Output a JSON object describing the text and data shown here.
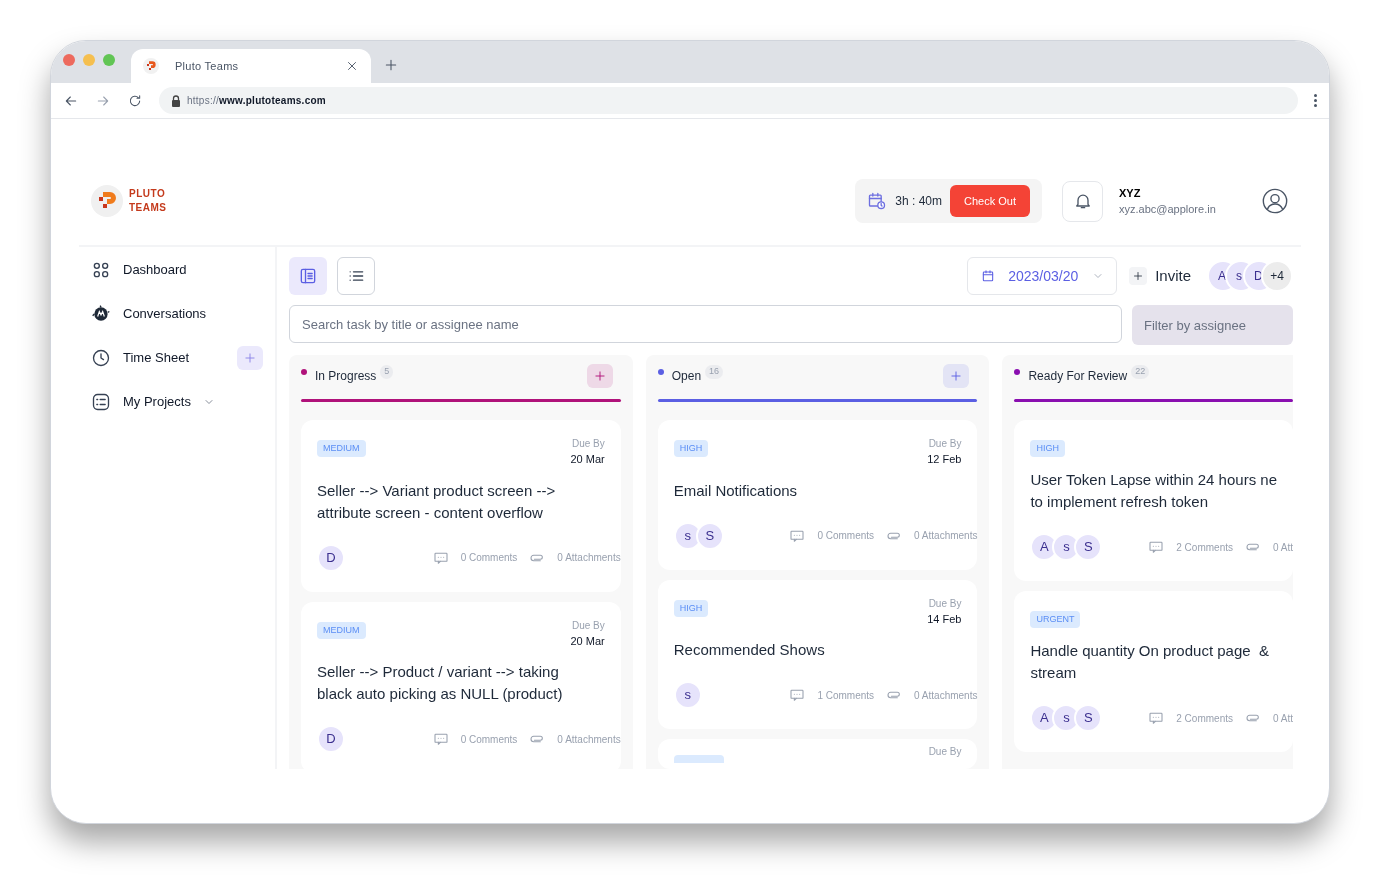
{
  "browser": {
    "tab_title": "Pluto Teams",
    "url_scheme": "https://",
    "url_host": "www.plutoteams.com"
  },
  "brand": {
    "line1": "PLUTO",
    "line2": "TEAMS"
  },
  "timer": {
    "value": "3h : 40m",
    "button": "Check Out"
  },
  "user": {
    "name": "XYZ",
    "email": "xyz.abc@applore.in"
  },
  "sidebar": {
    "items": [
      {
        "label": "Dashboard",
        "kind": "plain"
      },
      {
        "label": "Conversations",
        "kind": "plain"
      },
      {
        "label": "Time Sheet",
        "kind": "add"
      },
      {
        "label": "My Projects",
        "kind": "expand"
      }
    ]
  },
  "view_toggle": [
    {
      "kind": "board",
      "selected": true
    },
    {
      "kind": "list",
      "selected": false
    }
  ],
  "date": "2023/03/20",
  "invite": "Invite",
  "members": [
    "A",
    "s",
    "D"
  ],
  "more_members": "+4",
  "search": {
    "placeholder": "Search task by title or assignee name"
  },
  "filter": {
    "placeholder": "Filter by assignee"
  },
  "columns": [
    {
      "title": "In Progress",
      "count": "5",
      "color": "#b0127a",
      "add": true,
      "cards": [
        {
          "kind": "task",
          "priority": "MEDIUM",
          "due_label": "Due By",
          "due": "20 Mar",
          "title": "Seller --> Variant product screen -->\nattribute screen - content overflow",
          "assignees": [
            "D"
          ],
          "comments": "0 Comments",
          "attachments": "0 Attachments"
        },
        {
          "kind": "task",
          "priority": "MEDIUM",
          "due_label": "Due By",
          "due": "20 Mar",
          "title": "Seller --> Product / variant --> taking\nblack auto picking as NULL (product)",
          "assignees": [
            "D"
          ],
          "comments": "0 Comments",
          "attachments": "0 Attachments"
        }
      ]
    },
    {
      "title": "Open",
      "count": "16",
      "color": "#5b5fe3",
      "add": true,
      "cards": [
        {
          "kind": "task",
          "priority": "HIGH",
          "due_label": "Due By",
          "due": "12 Feb",
          "title": "Email Notifications",
          "assignees": [
            "s",
            "S"
          ],
          "comments": "0 Comments",
          "attachments": "0 Attachments"
        },
        {
          "kind": "task",
          "priority": "HIGH",
          "due_label": "Due By",
          "due": "14 Feb",
          "title": "Recommended Shows",
          "assignees": [
            "s"
          ],
          "comments": "1 Comments",
          "attachments": "0 Attachments"
        },
        {
          "kind": "stub",
          "due_label": "Due By"
        }
      ]
    },
    {
      "title": "Ready For Review",
      "count": "22",
      "color": "#8a0fb0",
      "add": false,
      "cards": [
        {
          "kind": "task",
          "priority": "HIGH",
          "title": "User Token Lapse within 24 hours ne\nto implement refresh token",
          "assignees": [
            "A",
            "s",
            "S"
          ],
          "comments": "2 Comments",
          "attachments": "0 Att"
        },
        {
          "kind": "task",
          "priority": "URGENT",
          "title": "Handle quantity On product page  &\nstream",
          "assignees": [
            "A",
            "s",
            "S"
          ],
          "comments": "2 Comments",
          "attachments": "0 Att"
        }
      ]
    }
  ]
}
